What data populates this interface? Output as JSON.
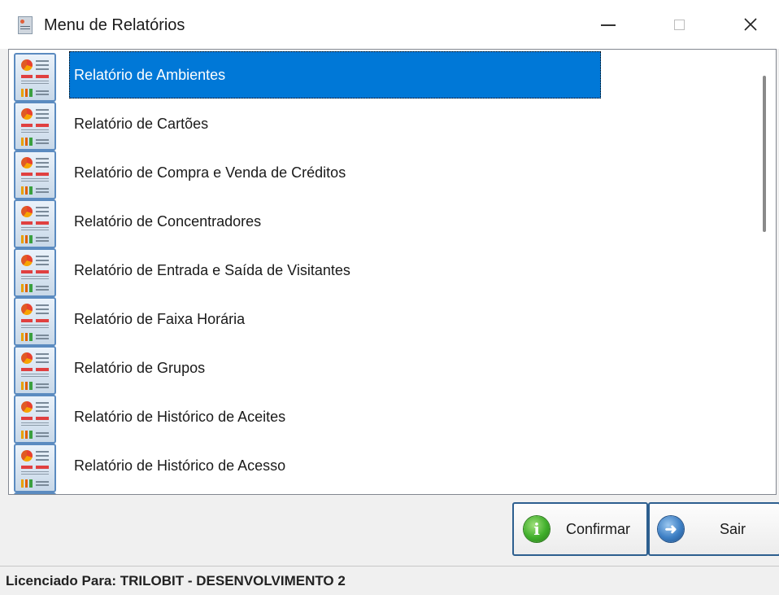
{
  "window": {
    "title": "Menu de Relatórios",
    "minimize_glyph": "—",
    "close_glyph": "✕"
  },
  "reports": {
    "selected_index": 0,
    "items": [
      {
        "label": "Relatório de Ambientes",
        "icon": "report-icon"
      },
      {
        "label": "Relatório de Cartões",
        "icon": "report-icon"
      },
      {
        "label": "Relatório de Compra e Venda de Créditos",
        "icon": "report-icon"
      },
      {
        "label": "Relatório de Concentradores",
        "icon": "report-icon"
      },
      {
        "label": "Relatório de Entrada e Saída de Visitantes",
        "icon": "report-icon"
      },
      {
        "label": "Relatório de Faixa Horária",
        "icon": "report-icon"
      },
      {
        "label": "Relatório de Grupos",
        "icon": "report-icon"
      },
      {
        "label": "Relatório de Histórico de Aceites",
        "icon": "report-icon"
      },
      {
        "label": "Relatório de Histórico de Acesso",
        "icon": "report-icon"
      },
      {
        "label": "",
        "icon": "report-icon"
      }
    ]
  },
  "buttons": {
    "confirm": {
      "label": "Confirmar",
      "icon": "info-icon",
      "glyph": "i"
    },
    "exit": {
      "label": "Sair",
      "icon": "exit-arrow-icon",
      "glyph": "➜"
    }
  },
  "status": {
    "license": "Licenciado Para: TRILOBIT - DESENVOLVIMENTO 2"
  },
  "colors": {
    "selection": "#0078d7",
    "button_border": "#2d5f8f"
  }
}
